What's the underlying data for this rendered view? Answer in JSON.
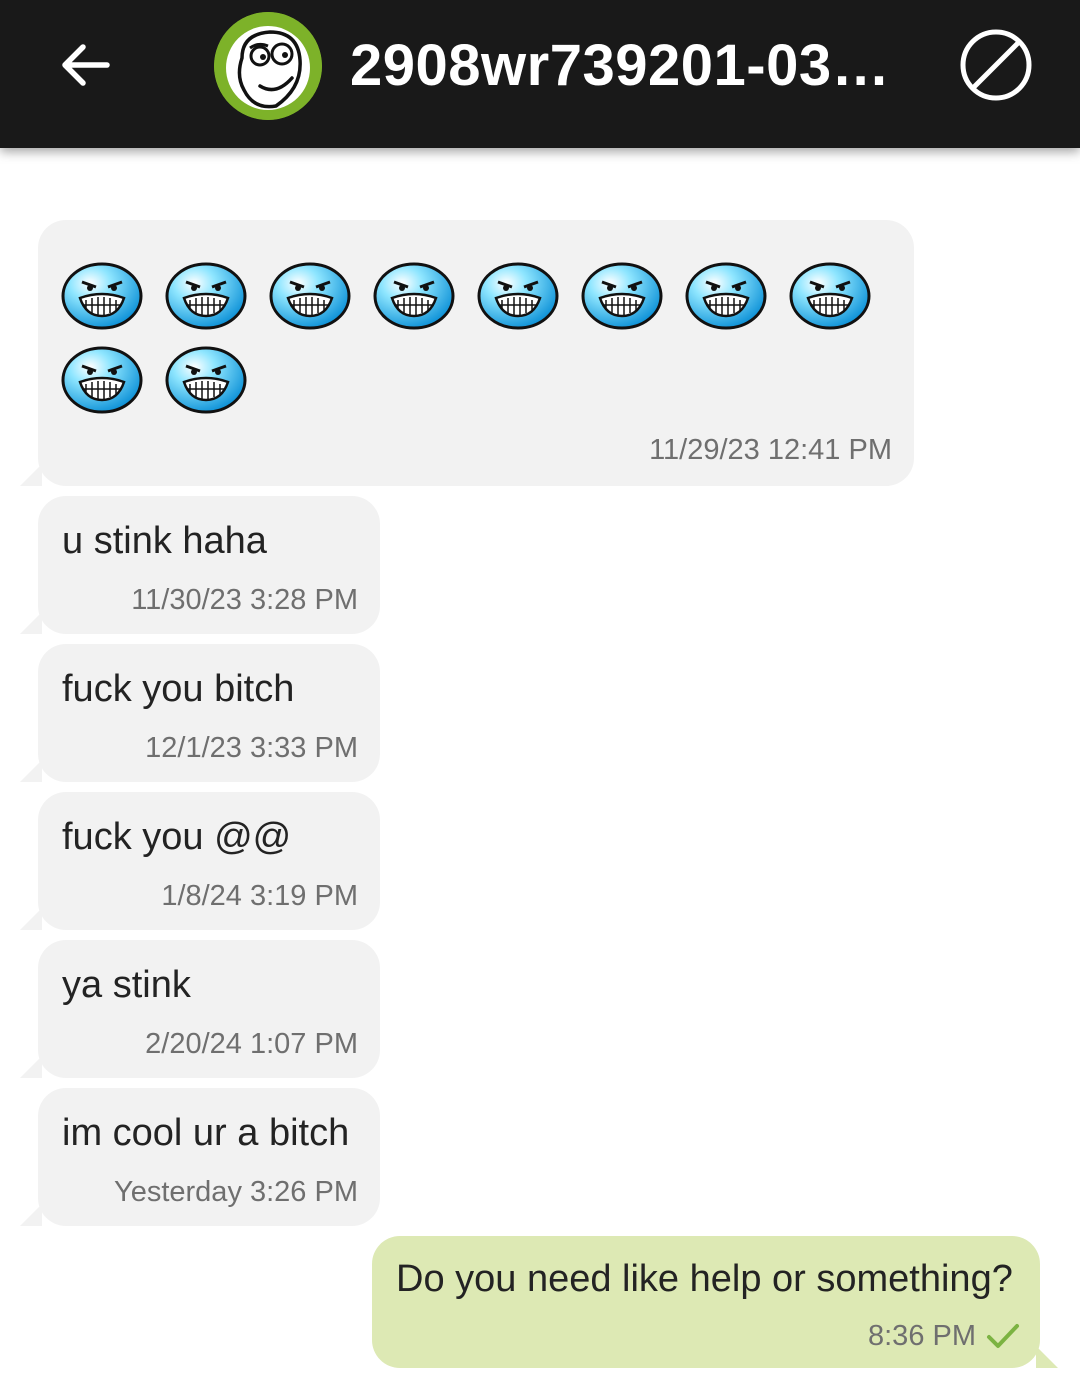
{
  "header": {
    "title": "2908wr739201-03…",
    "back_icon": "arrow-left-icon",
    "avatar_icon": "troll-face-avatar",
    "block_icon": "block-icon",
    "bar_color": "#191919",
    "avatar_ring_color": "#7db229"
  },
  "messages": [
    {
      "direction": "incoming",
      "emoji_name": "i-lied-rage-face",
      "emoji_count": 10,
      "timestamp": "11/29/23 12:41 PM"
    },
    {
      "direction": "incoming",
      "text": "u stink haha",
      "timestamp": "11/30/23 3:28 PM"
    },
    {
      "direction": "incoming",
      "text": "fuck you bitch",
      "timestamp": "12/1/23 3:33 PM"
    },
    {
      "direction": "incoming",
      "text": "fuck you @@",
      "timestamp": "1/8/24 3:19 PM"
    },
    {
      "direction": "incoming",
      "text": "ya stink",
      "timestamp": "2/20/24 1:07 PM"
    },
    {
      "direction": "incoming",
      "text": "im cool ur a bitch",
      "timestamp": "Yesterday 3:26 PM"
    },
    {
      "direction": "outgoing",
      "text": "Do you need like help or something?",
      "timestamp": "8:36 PM",
      "status_icon": "delivered-check-icon"
    }
  ],
  "colors": {
    "incoming_bubble": "#f2f2f2",
    "outgoing_bubble": "#dde9b4",
    "check": "#7cb342"
  }
}
